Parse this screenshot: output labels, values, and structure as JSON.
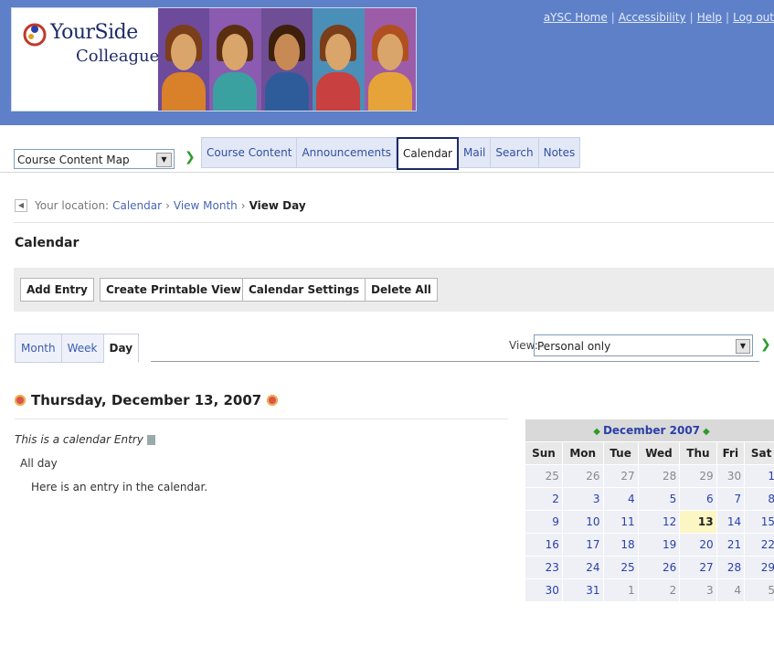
{
  "header": {
    "logo_line1": "YourSide",
    "logo_line2": "Colleague",
    "links": [
      "aYSC Home",
      "Accessibility",
      "Help",
      "Log out"
    ]
  },
  "nav": {
    "course_map_value": "Course Content Map",
    "tabs": [
      "Course Content",
      "Announcements",
      "Calendar",
      "Mail",
      "Search",
      "Notes"
    ],
    "active_tab": "Calendar"
  },
  "breadcrumb": {
    "prefix": "Your location:",
    "items": [
      "Calendar",
      "View Month"
    ],
    "current": "View Day"
  },
  "page_title": "Calendar",
  "toolbar": {
    "add_entry": "Add Entry",
    "printable": "Create Printable View",
    "settings": "Calendar Settings",
    "delete_all": "Delete All"
  },
  "view_tabs": {
    "month": "Month",
    "week": "Week",
    "day": "Day"
  },
  "view_filter": {
    "label": "View:",
    "value": "Personal only"
  },
  "day": {
    "date": "Thursday, December 13, 2007",
    "entry_title": "This is a calendar Entry",
    "entry_time": "All day",
    "entry_description": "Here is an entry in the calendar."
  },
  "mini_calendar": {
    "title": "December 2007",
    "weekdays": [
      "Sun",
      "Mon",
      "Tue",
      "Wed",
      "Thu",
      "Fri",
      "Sat"
    ],
    "weeks": [
      [
        "25",
        "26",
        "27",
        "28",
        "29",
        "30",
        "1"
      ],
      [
        "2",
        "3",
        "4",
        "5",
        "6",
        "7",
        "8"
      ],
      [
        "9",
        "10",
        "11",
        "12",
        "13",
        "14",
        "15"
      ],
      [
        "16",
        "17",
        "18",
        "19",
        "20",
        "21",
        "22"
      ],
      [
        "23",
        "24",
        "25",
        "26",
        "27",
        "28",
        "29"
      ],
      [
        "30",
        "31",
        "1",
        "2",
        "3",
        "4",
        "5"
      ]
    ],
    "today": "13"
  },
  "colors": {
    "header_bg": "#5d80c8",
    "link": "#2a3fa8",
    "go_arrow": "#2c9a2c"
  }
}
